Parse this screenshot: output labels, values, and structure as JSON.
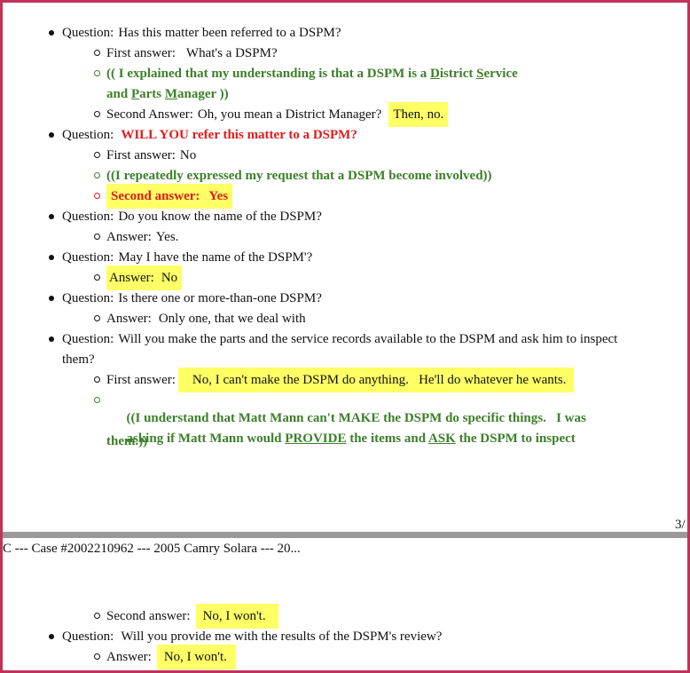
{
  "items": [
    {
      "label": "Question:",
      "text": "Has this matter been referred to a DSPM?"
    },
    {
      "label": "First answer:",
      "text": "What's a DSPM?"
    },
    {
      "text_a": "(( I explained that my understanding is that a DSPM is a ",
      "u1": "D",
      "t1": "istrict ",
      "u2": "S",
      "t2": "ervice",
      "text_b": "and ",
      "u3": "P",
      "t3": "arts ",
      "u4": "M",
      "t4": "anager ))"
    },
    {
      "label": "Second Answer:",
      "text": "Oh, you mean a District Manager?",
      "highlight": "Then, no."
    },
    {
      "label": "Question:",
      "text": "WILL YOU refer this matter to a DSPM?"
    },
    {
      "label": "First answer:",
      "text": "No"
    },
    {
      "text": "((I repeatedly expressed my request that a DSPM become involved))"
    },
    {
      "label": "Second answer:",
      "text": "Yes"
    },
    {
      "label": "Question:",
      "text": "Do you know the name of the DSPM?"
    },
    {
      "label": "Answer:",
      "text": "Yes."
    },
    {
      "label": "Question:",
      "text": "May I have the name of the DSPM'?"
    },
    {
      "label": "Answer:",
      "text": "No"
    },
    {
      "label": "Question:",
      "text": "Is there one or more-than-one DSPM?"
    },
    {
      "label": "Answer:",
      "text": "Only one, that we deal with"
    },
    {
      "label": "Question:",
      "text": "Will you make the parts and the service records available to the DSPM and ask him to inspect",
      "text2": "them?"
    },
    {
      "label": "First answer:",
      "highlight": "No, I can't make the DSPM do anything.   He'll do whatever he wants."
    },
    {
      "line1": "((I understand that Matt Mann can't MAKE the DSPM do specific things.   I was",
      "line2_a": "asking if Matt Mann would ",
      "line2_u1": "PROVIDE",
      "line2_b": " the items and ",
      "line2_u2": "ASK",
      "line2_c": " the DSPM to inspect",
      "line3": "them.))"
    },
    {
      "label": "Second answer:",
      "highlight": "No, I won't."
    },
    {
      "label": "Question:",
      "text": "Will you provide me with the results of the DSPM's review?"
    },
    {
      "label": "Answer:",
      "highlight": "No, I won't."
    }
  ],
  "page_number": "3/",
  "running_header": "C --- Case #2002210962 --- 2005 Camry Solara --- 20...",
  "colors": {
    "border": "#c0325a",
    "highlight": "#ffff66",
    "green": "#3d7f2a",
    "red": "#e01b1b",
    "page_divider": "#999999"
  }
}
